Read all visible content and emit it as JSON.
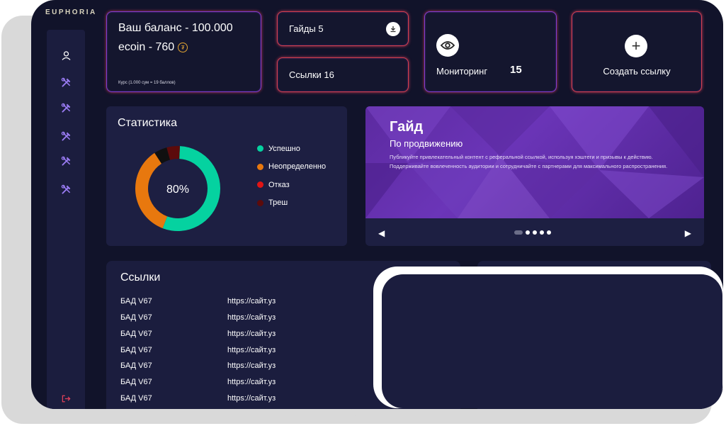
{
  "brand": {
    "logo": "EUPHORIA",
    "logo_sub": "......"
  },
  "sidebar": {
    "items": [
      {
        "icon": "user-icon"
      },
      {
        "icon": "tools-icon"
      },
      {
        "icon": "tools-icon"
      },
      {
        "icon": "tools-icon"
      },
      {
        "icon": "tools-icon"
      },
      {
        "icon": "tools-icon"
      }
    ],
    "logout_icon": "logout-icon"
  },
  "balance": {
    "line1": "Ваш баланс - 100.000",
    "line2": "ecoin - 760",
    "coin_symbol": "₮",
    "rate": "Курс (1.000 сум = 19 баллов)"
  },
  "guides_card": {
    "label": "Гайды 5"
  },
  "links_card": {
    "label": "Ссылки 16"
  },
  "monitoring_card": {
    "label": "Мониторинг",
    "count": "15"
  },
  "create_card": {
    "label": "Создать ссылку",
    "plus": "+"
  },
  "statistics": {
    "title": "Статистика",
    "center_value": "80%",
    "legend": [
      {
        "label": "Успешно",
        "color": "#05d2a0"
      },
      {
        "label": "Неопределенно",
        "color": "#e8780e"
      },
      {
        "label": "Отказ",
        "color": "#e11414"
      },
      {
        "label": "Треш",
        "color": "#5c0b0b"
      }
    ],
    "slices": [
      {
        "name": "Успешно",
        "value": 0.55,
        "color": "#05d2a0"
      },
      {
        "name": "Неопределенно",
        "value": 0.35,
        "color": "#e8780e"
      },
      {
        "name": "Отказ",
        "value": 0.05,
        "color": "#101010"
      },
      {
        "name": "Треш",
        "value": 0.05,
        "color": "#5c0b0b"
      }
    ]
  },
  "guide": {
    "title": "Гайд",
    "subtitle": "По продвижению",
    "text": "Публикуйте привлекательный контент с реферальной ссылкой, используя хэштеги и призывы к действию. Поддерживайте вовлеченность аудитории и сотрудничайте с партнерами для максимального распространения.",
    "prev": "◀",
    "next": "▶",
    "pages": 5,
    "active_page": 1
  },
  "links": {
    "title": "Ссылки",
    "rows": [
      {
        "name": "БАД V67",
        "url": "https://сайт.уз"
      },
      {
        "name": "БАД V67",
        "url": "https://сайт.уз"
      },
      {
        "name": "БАД V67",
        "url": "https://сайт.уз"
      },
      {
        "name": "БАД V67",
        "url": "https://сайт.уз"
      },
      {
        "name": "БАД V67",
        "url": "https://сайт.уз"
      },
      {
        "name": "БАД V67",
        "url": "https://сайт.уз"
      },
      {
        "name": "БАД V67",
        "url": "https://сайт.уз"
      }
    ]
  }
}
